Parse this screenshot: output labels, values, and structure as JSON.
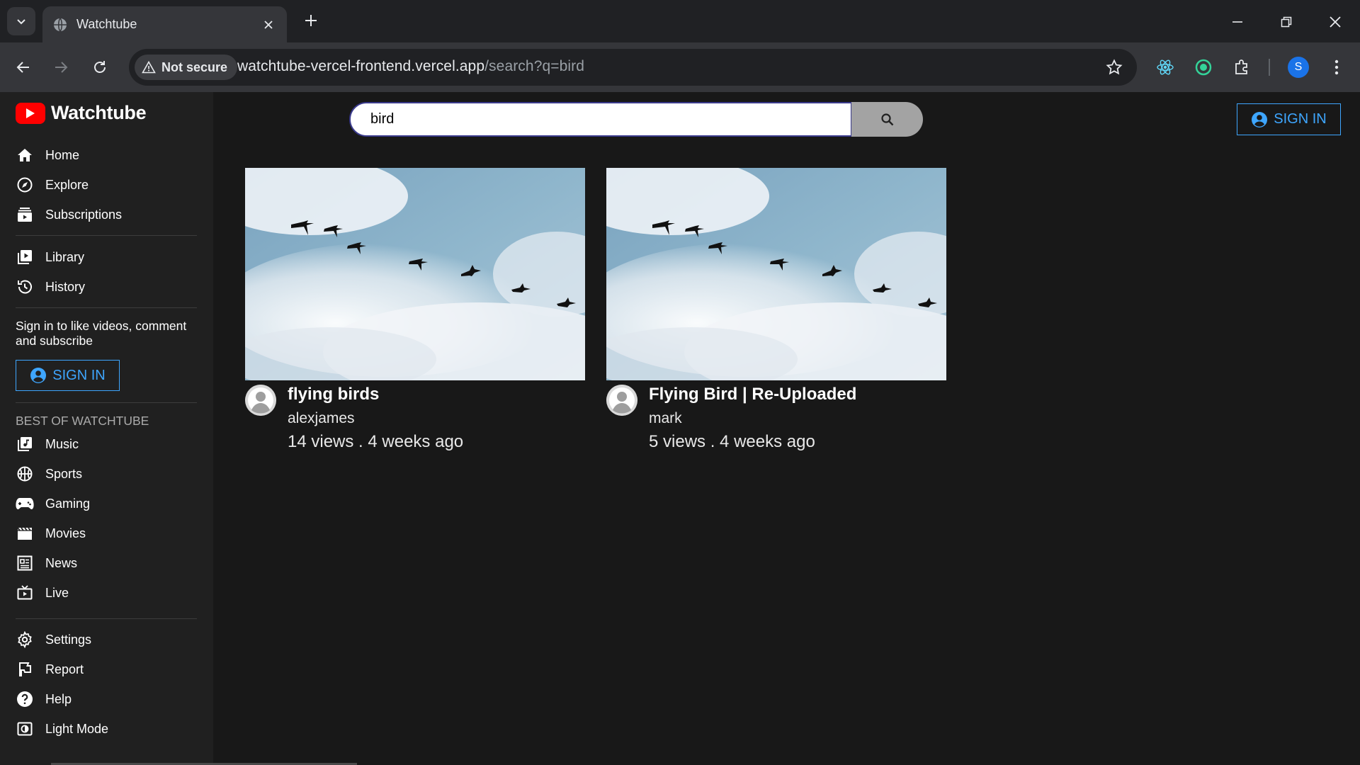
{
  "browser": {
    "tab_title": "Watchtube",
    "security_label": "Not secure",
    "url_host": "watchtube-vercel-frontend.vercel.app",
    "url_path": "/search?q=bird",
    "profile_initial": "S",
    "profile_color": "#1a73e8"
  },
  "app": {
    "name": "Watchtube",
    "brand_color": "#ff0000",
    "accent_color": "#3ea6ff"
  },
  "sidebar": {
    "primary": [
      {
        "label": "Home",
        "icon": "home-icon"
      },
      {
        "label": "Explore",
        "icon": "compass-icon"
      },
      {
        "label": "Subscriptions",
        "icon": "subscriptions-icon"
      }
    ],
    "library": [
      {
        "label": "Library",
        "icon": "video-library-icon"
      },
      {
        "label": "History",
        "icon": "history-icon"
      }
    ],
    "signin_message": "Sign in to like videos, comment and subscribe",
    "signin_label": "SIGN IN",
    "section_title": "BEST OF WATCHTUBE",
    "best_of": [
      {
        "label": "Music",
        "icon": "music-library-icon"
      },
      {
        "label": "Sports",
        "icon": "sports-ball-icon"
      },
      {
        "label": "Gaming",
        "icon": "gamepad-icon"
      },
      {
        "label": "Movies",
        "icon": "movie-icon"
      },
      {
        "label": "News",
        "icon": "newspaper-icon"
      },
      {
        "label": "Live",
        "icon": "live-tv-icon"
      }
    ],
    "footer": [
      {
        "label": "Settings",
        "icon": "gear-icon"
      },
      {
        "label": "Report",
        "icon": "flag-icon"
      },
      {
        "label": "Help",
        "icon": "help-icon"
      },
      {
        "label": "Light Mode",
        "icon": "brightness-icon"
      }
    ]
  },
  "header": {
    "search_value": "bird",
    "signin_label": "SIGN IN"
  },
  "results": [
    {
      "title": "flying birds",
      "channel": "alexjames",
      "views": "14 views",
      "age": "4 weeks ago"
    },
    {
      "title": "Flying Bird | Re-Uploaded",
      "channel": "mark",
      "views": "5 views",
      "age": "4 weeks ago"
    }
  ]
}
